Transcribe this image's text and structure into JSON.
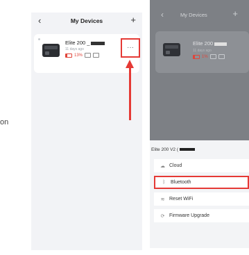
{
  "side_text": "on",
  "left_phone": {
    "title": "My Devices",
    "back_icon": "‹",
    "add_icon": "+",
    "device": {
      "name": "Elite 200 _",
      "time": "11 days ago",
      "battery": "13%"
    },
    "more_icon": "···"
  },
  "right_phone": {
    "title": "My Devices",
    "back_icon": "‹",
    "add_icon": "+",
    "device": {
      "name": "Elite 200",
      "time": "11 days ago",
      "battery": "1%"
    },
    "sheet": {
      "title": "Elite 200 V2 (",
      "options": [
        {
          "icon": "cloud-icon",
          "glyph": "☁",
          "label": "Cloud"
        },
        {
          "icon": "bluetooth-icon",
          "glyph": "ᛒ",
          "label": "Bluetooth"
        },
        {
          "icon": "wifi-icon",
          "glyph": "≋",
          "label": "Reset WiFi"
        },
        {
          "icon": "upgrade-icon",
          "glyph": "⟳",
          "label": "Firmware Upgrade"
        }
      ]
    }
  },
  "colors": {
    "highlight": "#e53935",
    "battery_low": "#e0453a"
  }
}
